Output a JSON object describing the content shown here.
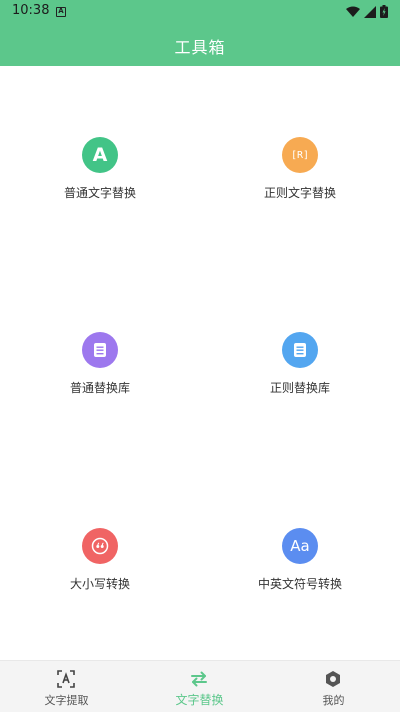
{
  "status_bar": {
    "time": "10:38",
    "notification_icon": "a-notification-icon",
    "icons": [
      "wifi-icon",
      "signal-icon",
      "battery-icon"
    ]
  },
  "app_bar": {
    "title": "工具箱",
    "color": "#5cc78b"
  },
  "tools": [
    {
      "label": "普通文字替换",
      "icon": "letter-a-icon",
      "icon_text": "A",
      "color": "#42c487"
    },
    {
      "label": "正则文字替换",
      "icon": "regex-icon",
      "icon_text": "[R]",
      "color": "#f7aa52"
    },
    {
      "label": "普通替换库",
      "icon": "book-icon",
      "color": "#9d78ee"
    },
    {
      "label": "正则替换库",
      "icon": "book-icon",
      "color": "#53a6f0"
    },
    {
      "label": "大小写转换",
      "icon": "quote-icon",
      "color": "#f06464"
    },
    {
      "label": "中英文符号转换",
      "icon": "aa-icon",
      "icon_text": "Aa",
      "color": "#5b8df0"
    }
  ],
  "bottom_nav": {
    "active_color": "#5cc78b",
    "items": [
      {
        "label": "文字提取",
        "icon": "text-scan-icon",
        "active": false
      },
      {
        "label": "文字替换",
        "icon": "swap-arrows-icon",
        "active": true
      },
      {
        "label": "我的",
        "icon": "hexagon-settings-icon",
        "active": false
      }
    ]
  }
}
